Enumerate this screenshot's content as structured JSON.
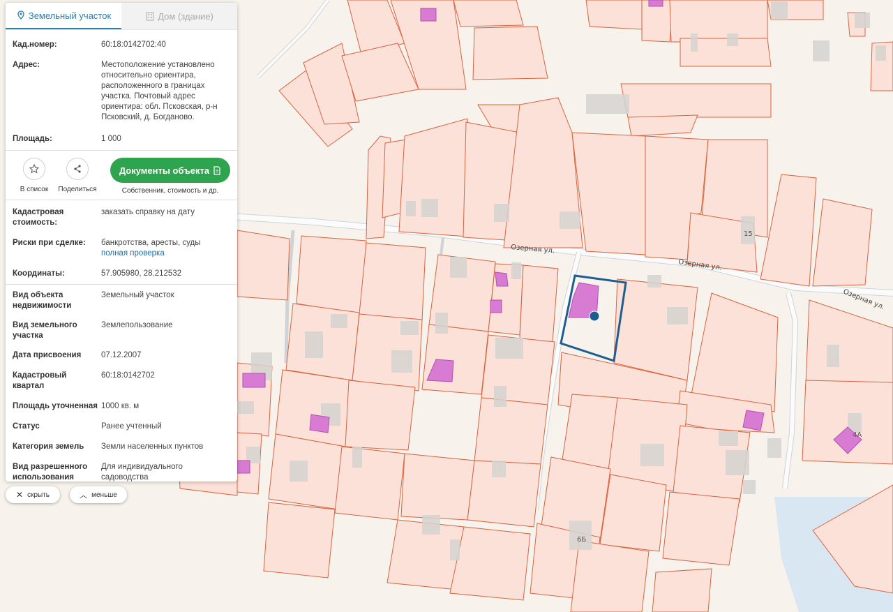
{
  "tabs": {
    "land": "Земельный участок",
    "house": "Дом (здание)"
  },
  "top": {
    "cad_label": "Кад.номер:",
    "cad_value": "60:18:0142702:40",
    "addr_label": "Адрес:",
    "addr_value": "Местоположение установлено относительно ориентира, расположенного в границах участка. Почтовый адрес ориентира: обл. Псковская, р-н Псковский, д. Богданово.",
    "area_label": "Площадь:",
    "area_value": "1 000"
  },
  "actions": {
    "list": "В список",
    "share": "Поделиться",
    "docs": "Документы объекта",
    "docs_sub": "Собственник, стоимость и др."
  },
  "details": {
    "cost_label": "Кадастровая стоимость:",
    "cost_link": "заказать справку на дату",
    "risk_label": "Риски при сделке:",
    "risk_value": "банкротства, аресты, суды",
    "risk_link": "полная проверка",
    "coord_label": "Координаты:",
    "coord_value": "57.905980, 28.212532"
  },
  "props": [
    {
      "k": "Вид объекта недвижимости",
      "v": "Земельный участок"
    },
    {
      "k": "Вид земельного участка",
      "v": "Землепользование"
    },
    {
      "k": "Дата присвоения",
      "v": "07.12.2007"
    },
    {
      "k": "Кадастровый квартал",
      "v": "60:18:0142702"
    },
    {
      "k": "Площадь уточненная",
      "v": "1000 кв. м"
    },
    {
      "k": "Статус",
      "v": "Ранее учтенный"
    },
    {
      "k": "Категория земель",
      "v": "Земли населенных пунктов"
    },
    {
      "k": "Вид разрешенного использования",
      "v": "Для индивидуального садоводства"
    }
  ],
  "controls": {
    "hide": "скрыть",
    "less": "меньше"
  },
  "map": {
    "street1": "Озерная ул.",
    "street2": "Озерная ул.",
    "street3": "Озерная ул.",
    "num15": "15",
    "num4a": "4А",
    "num6b": "6Б",
    "parcel_color": "#fbe1d8",
    "border_color": "#d9633e",
    "building_color": "#d77bd3",
    "selected_color": "#1d5d8f"
  }
}
